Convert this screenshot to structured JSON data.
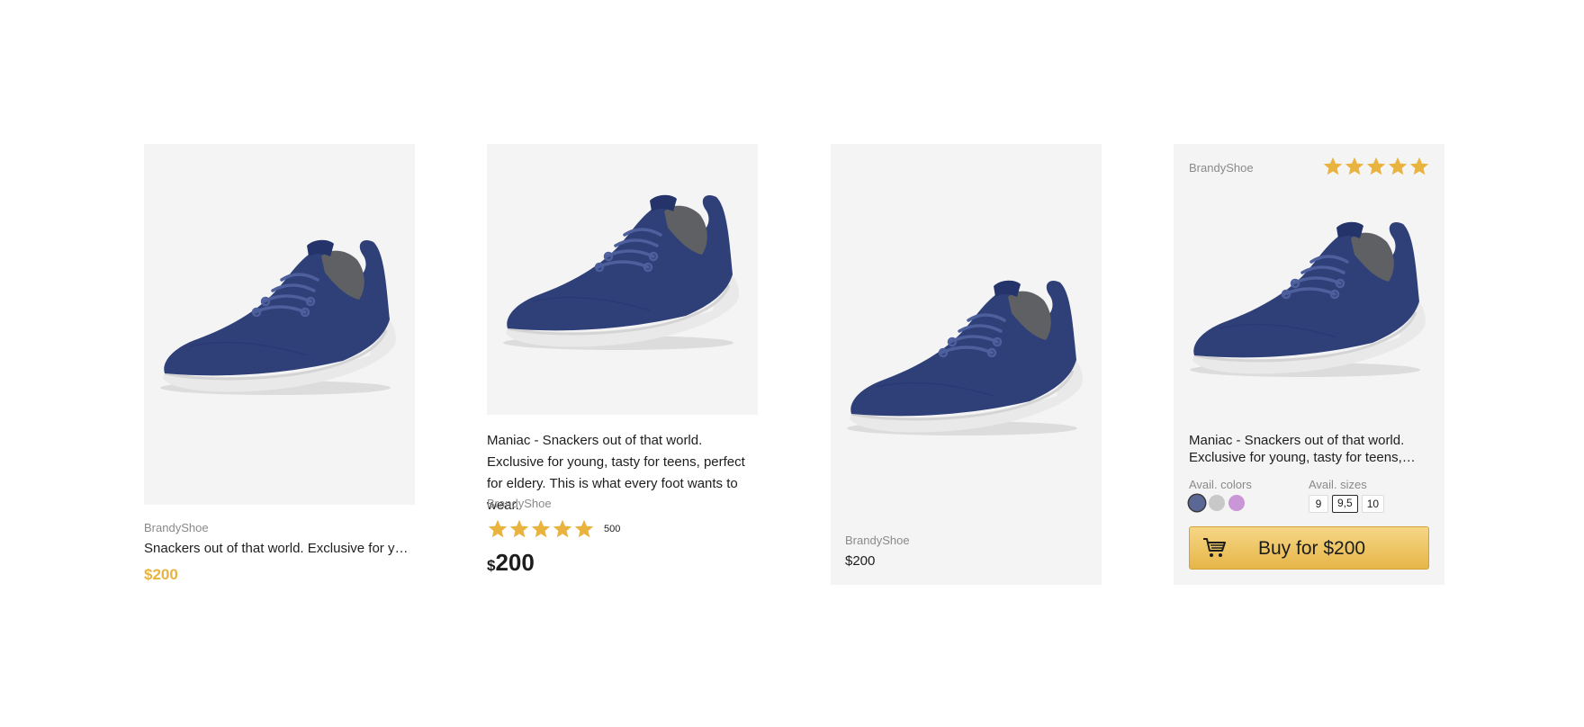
{
  "colors": {
    "star": "#e8b33f",
    "accent_price": "#e8b33f",
    "image_bg": "#f4f4f4",
    "shoe_navy": "#2f3f78",
    "sole": "#e9e9e9"
  },
  "cards": [
    {
      "brand": "BrandyShoe",
      "description": "Snackers out of that world. Exclusive for young, tasty for teens, perfect for eldery.",
      "price": "$200"
    },
    {
      "description": "Maniac - Snackers out of that world. Exclusive for young, tasty for teens, perfect for eldery. This is what every foot wants to wear.",
      "brand": "BrandyShoe",
      "rating": 5,
      "rating_count": "500",
      "currency": "$",
      "price": "200"
    },
    {
      "brand": "BrandyShoe",
      "price": "$200"
    },
    {
      "brand": "BrandyShoe",
      "rating": 5,
      "description": "Maniac - Snackers out of that world. Exclusive for young, tasty for teens, perfect for eldery.",
      "colors_label": "Avail. colors",
      "sizes_label": "Avail. sizes",
      "color_options": [
        "#5a6896",
        "#c8c8c8",
        "#c996d6"
      ],
      "selected_color": 0,
      "sizes": [
        "9",
        "9,5",
        "10"
      ],
      "selected_size": 1,
      "buy_label": "Buy for $200",
      "buy_icon": "cart-icon"
    }
  ]
}
